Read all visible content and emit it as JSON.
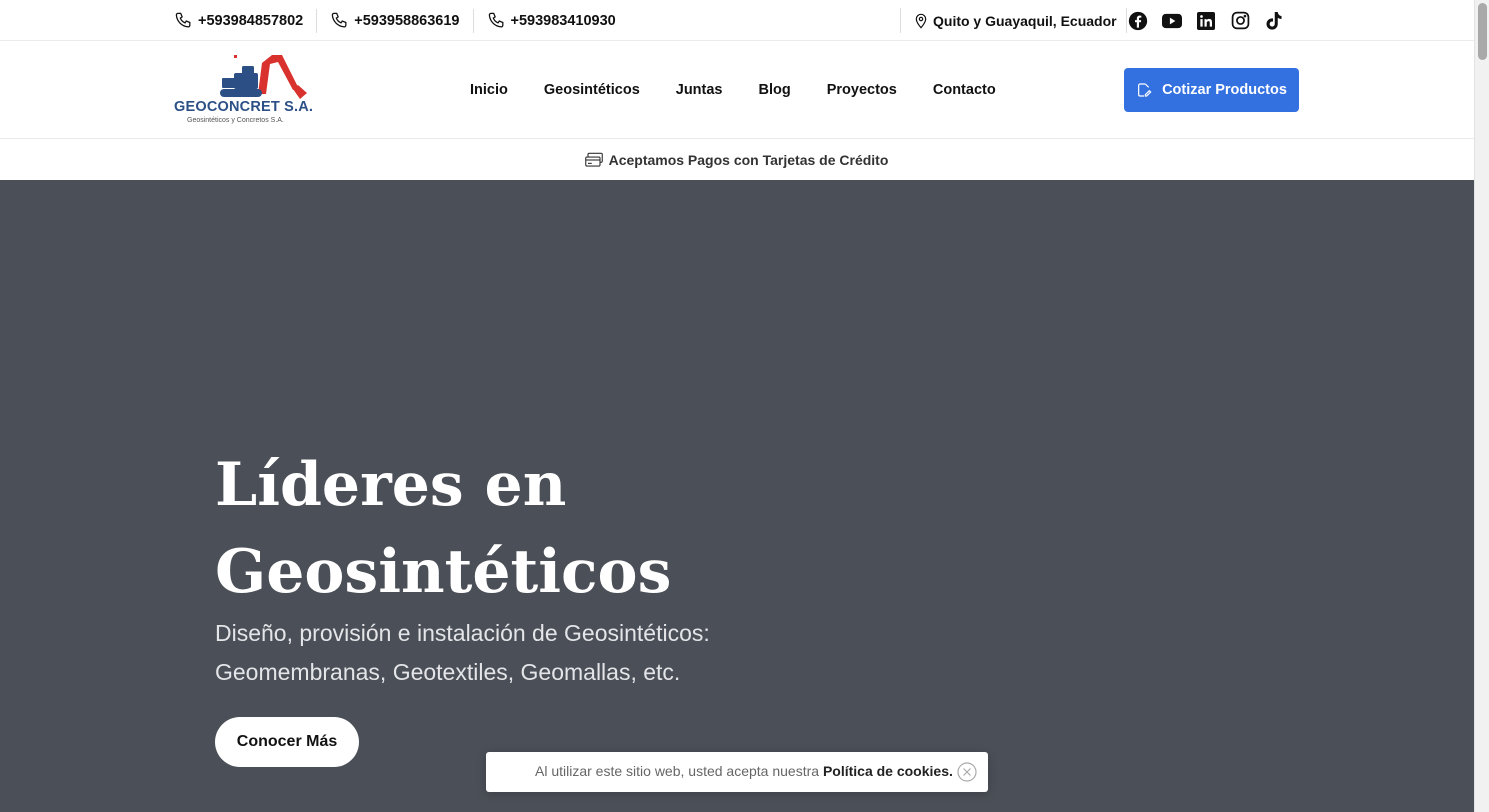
{
  "topbar": {
    "phones": [
      "+593984857802",
      "+593958863619",
      "+593983410930"
    ],
    "location": "Quito y Guayaquil, Ecuador",
    "social_icons": [
      "facebook-icon",
      "youtube-icon",
      "linkedin-icon",
      "instagram-icon",
      "tiktok-icon"
    ]
  },
  "header": {
    "logo_name": "GEOCONCRET S.A.",
    "logo_sub": "Geosintéticos y Concretos S.A.",
    "nav": [
      "Inicio",
      "Geosintéticos",
      "Juntas",
      "Blog",
      "Proyectos",
      "Contacto"
    ],
    "cta_label": "Cotizar Productos"
  },
  "strip": {
    "text": "Aceptamos Pagos con Tarjetas de Crédito"
  },
  "hero": {
    "title_line1": "Líderes en",
    "title_line2": "Geosintéticos",
    "subtitle_line1": "Diseño, provisión e instalación de Geosintéticos:",
    "subtitle_line2": "Geomembranas, Geotextiles, Geomallas, etc.",
    "button_label": "Conocer Más"
  },
  "cookie": {
    "text": "Al utilizar este sitio web, usted acepta nuestra",
    "link": "Política de cookies."
  },
  "colors": {
    "accent": "#3370e0",
    "hero_bg": "#4b4f57",
    "logo_blue": "#2c4f86",
    "logo_red": "#d9322e"
  }
}
